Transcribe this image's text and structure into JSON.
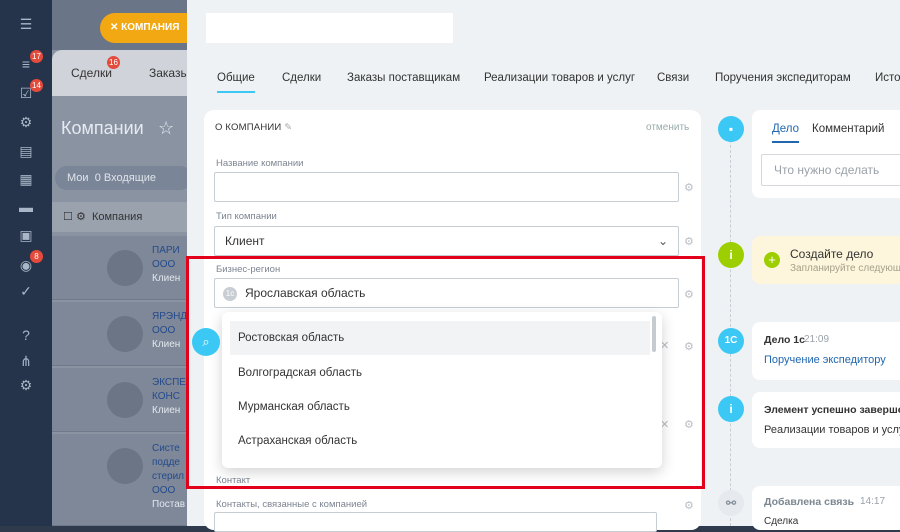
{
  "background": {
    "chip": "КОМПАНИЯ",
    "tabs": [
      "Сделки",
      "Заказы"
    ],
    "tab_badge": "16",
    "title": "Компании",
    "filter_label": "Мои",
    "filter_count": "0",
    "filter_text": "Входящие",
    "column_header": "Компания",
    "rows": [
      {
        "line1": "ПАРИ",
        "line2": "ООО",
        "line3": "Клиен"
      },
      {
        "line1": "ЯРЭНД",
        "line2": "ООО",
        "line3": "Клиен"
      },
      {
        "line1": "ЭКСПЕ",
        "line2": "КОНС",
        "line3": "Клиен"
      },
      {
        "line1": "Систе",
        "line2": "подде",
        "line3": "стерил",
        "line4": "ООО",
        "line5": "Постав"
      }
    ]
  },
  "sidebar": {
    "badges": [
      "17",
      "14",
      "8"
    ]
  },
  "tabs": [
    "Общие",
    "Сделки",
    "Заказы поставщикам",
    "Реализации товаров и услуг",
    "Связи",
    "Поручения экспедиторам",
    "Исто"
  ],
  "card": {
    "title": "О КОМПАНИИ",
    "cancel": "отменить",
    "fields": {
      "name_label": "Название компании",
      "type_label": "Тип компании",
      "type_value": "Клиент",
      "region_label": "Бизнес-регион",
      "region_value": "Ярославская область",
      "contact_label": "Контакт",
      "contacts_label": "Контакты, связанные с компанией"
    }
  },
  "dropdown_options": [
    "Ростовская область",
    "Волгоградская область",
    "Мурманская область",
    "Астраханская область"
  ],
  "timeline": {
    "tabs": [
      "Дело",
      "Комментарий"
    ],
    "todo_placeholder": "Что нужно сделать",
    "create_title": "Создайте дело",
    "create_sub": "Запланируйте следующ",
    "task_title": "Дело 1с",
    "task_time": "21:09",
    "task_link": "Поручение экспедитору",
    "success_title": "Элемент успешно завершен",
    "success_text": "Реализации товаров и услу",
    "link_title": "Добавлена связь",
    "link_time": "14:17",
    "link_text": "Сделка"
  }
}
